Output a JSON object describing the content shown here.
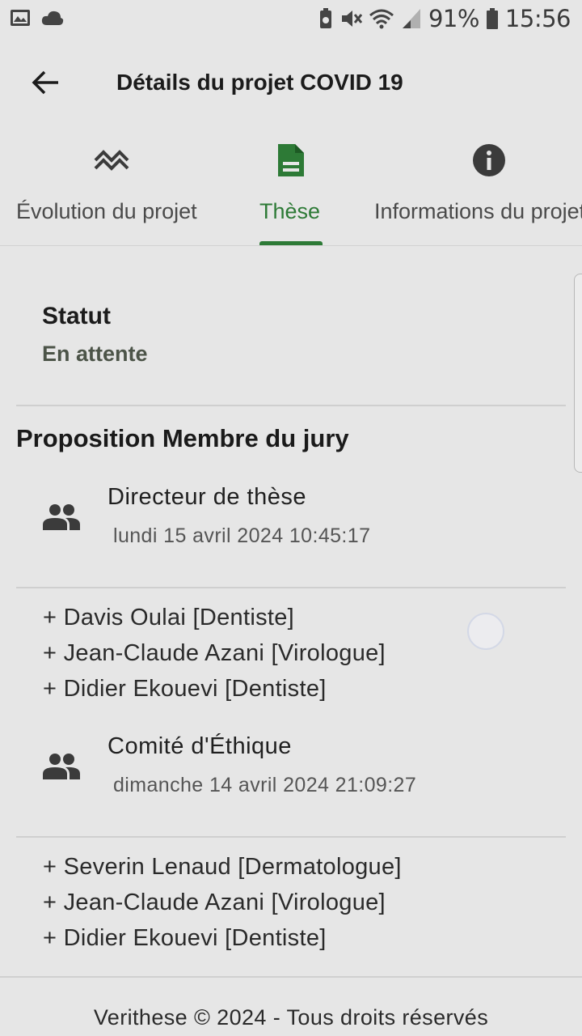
{
  "statusbar": {
    "battery": "91%",
    "time": "15:56",
    "icons": [
      "image-icon",
      "cloud-icon",
      "data-saver-icon",
      "mute-icon",
      "wifi-icon",
      "signal-icon",
      "battery-icon"
    ]
  },
  "appbar": {
    "title": "Détails du projet COVID 19",
    "back_icon": "arrow-back-icon"
  },
  "tabs": [
    {
      "label": "Évolution du projet",
      "icon": "trending-icon",
      "active": false
    },
    {
      "label": "Thèse",
      "icon": "document-icon",
      "active": true
    },
    {
      "label": "Informations du projet",
      "icon": "info-icon",
      "active": false
    }
  ],
  "status": {
    "label": "Statut",
    "value": "En attente"
  },
  "section_title": "Proposition Membre du jury",
  "juries": [
    {
      "title": "Directeur de thèse",
      "date": "lundi 15 avril 2024 10:45:17",
      "members": [
        "+ Davis Oulai [Dentiste]",
        "+ Jean-Claude Azani [Virologue]",
        "+ Didier Ekouevi [Dentiste]"
      ]
    },
    {
      "title": "Comité d'Éthique",
      "date": "dimanche 14 avril 2024 21:09:27",
      "members": [
        "+ Severin Lenaud [Dermatologue]",
        "+ Jean-Claude Azani [Virologue]",
        "+ Didier Ekouevi [Dentiste]"
      ]
    }
  ],
  "footer": "Verithese © 2024 - Tous droits réservés",
  "colors": {
    "accent": "#2d7a36",
    "background": "#e6e6e6",
    "icon_dark": "#3b3b3b"
  }
}
